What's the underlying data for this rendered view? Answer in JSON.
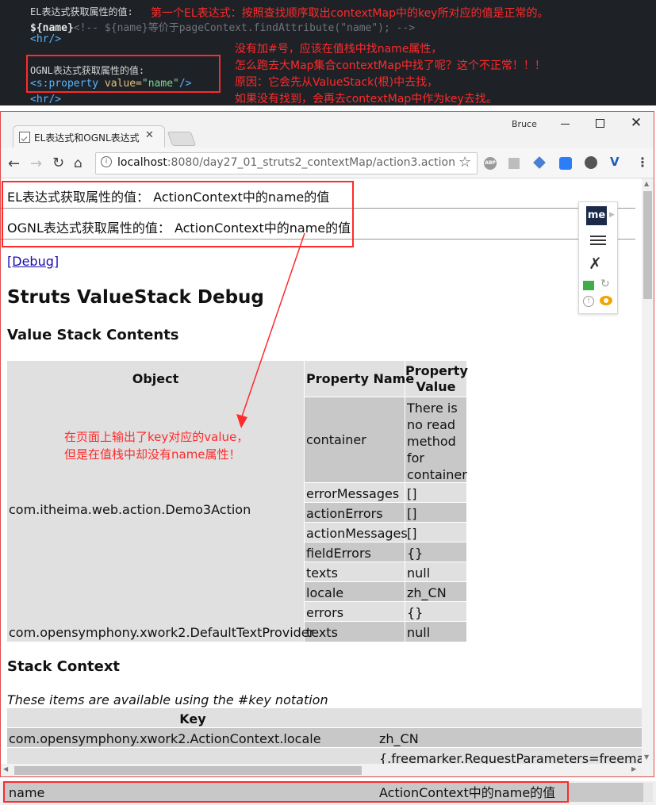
{
  "code": {
    "el_label": "EL表达式获取属性的值:",
    "el_expr": "${name}",
    "el_comment": "<!-- ${name}等价于pageContext.findAttribute(\"name\"); -->",
    "hr1": "<hr/>",
    "ognl_label": "OGNL表达式获取属性的值:",
    "ognl_tag": "<s:property",
    "ognl_attr": "value=",
    "ognl_value": "\"name\"",
    "ognl_close": "/>",
    "hr2": "<hr/>",
    "note_top": "第一个EL表达式：按照查找顺序取出contextMap中的key所对应的值是正常的。",
    "note_lines": [
      "没有加#号，应该在值栈中找name属性，",
      "怎么跑去大Map集合contextMap中找了呢？这个不正常！！！",
      "原因：它会先从ValueStack(根)中去找，",
      "如果没有找到，会再去contextMap中作为key去找。"
    ]
  },
  "browser": {
    "user": "Bruce",
    "tab_title": "EL表达式和OGNL表达式",
    "url_host": "localhost",
    "url_rest": ":8080/day27_01_struts2_contextMap/action3.action",
    "ext_abp": "ABP"
  },
  "page": {
    "el_line": "EL表达式获取属性的值：  ActionContext中的name的值",
    "ognl_line": "OGNL表达式获取属性的值：  ActionContext中的name的值",
    "debug_link": "[Debug]",
    "heading": "Struts ValueStack Debug",
    "vs_heading": "Value Stack Contents",
    "col_object": "Object",
    "col_prop_name": "Property Name",
    "col_prop_value_1": "Property",
    "col_prop_value_2": "Value",
    "object1": "com.itheima.web.action.Demo3Action",
    "object2": "com.opensymphony.xwork2.DefaultTextProvider",
    "rows": [
      {
        "name": "container",
        "value": "There is no read method for container"
      },
      {
        "name": "errorMessages",
        "value": "[]"
      },
      {
        "name": "actionErrors",
        "value": "[]"
      },
      {
        "name": "actionMessages",
        "value": "[]"
      },
      {
        "name": "fieldErrors",
        "value": "{}"
      },
      {
        "name": "texts",
        "value": "null"
      },
      {
        "name": "locale",
        "value": "zh_CN"
      },
      {
        "name": "errors",
        "value": "{}"
      }
    ],
    "row2_name": "texts",
    "row2_value": "null",
    "stack_heading": "Stack Context",
    "stack_note": "These items are available using the #key notation",
    "key_header": "Key",
    "ctx1_key": "com.opensymphony.xwork2.ActionContext.locale",
    "ctx1_value": "zh_CN",
    "ctx2_value": "{.freemarker.RequestParameters=freemarker",
    "bottom_key": "name",
    "bottom_value": "ActionContext中的name的值",
    "annotation": [
      "在页面上输出了key对应的value，",
      "但是在值栈中却没有name属性！"
    ]
  },
  "colors": {
    "annotation_red": "#ff2a2a",
    "code_bg": "#1e2227",
    "link_blue": "#1a0dab"
  }
}
